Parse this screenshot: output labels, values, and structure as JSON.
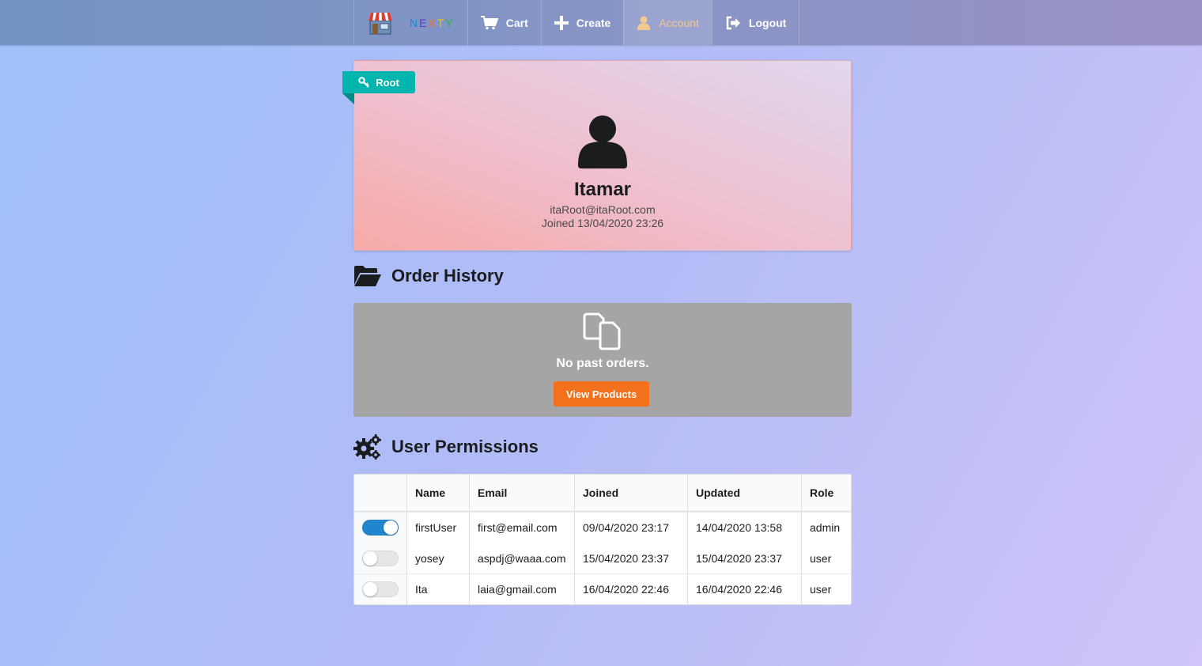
{
  "nav": {
    "brand": "NEXTY",
    "cart": "Cart",
    "create": "Create",
    "account": "Account",
    "logout": "Logout",
    "accent": "#f2c894"
  },
  "profile": {
    "role_badge": "Root",
    "name": "Itamar",
    "email": "itaRoot@itaRoot.com",
    "joined": "Joined 13/04/2020 23:26"
  },
  "orders": {
    "title": "Order History",
    "empty_text": "No past orders.",
    "button": "View Products",
    "button_color": "#f2711c"
  },
  "permissions": {
    "title": "User Permissions",
    "columns": [
      "",
      "Name",
      "Email",
      "Joined",
      "Updated",
      "Role"
    ],
    "rows": [
      {
        "enabled": true,
        "name": "firstUser",
        "email": "first@email.com",
        "joined": "09/04/2020 23:17",
        "updated": "14/04/2020 13:58",
        "role": "admin"
      },
      {
        "enabled": false,
        "name": "yosey",
        "email": "aspdj@waaa.com",
        "joined": "15/04/2020 23:37",
        "updated": "15/04/2020 23:37",
        "role": "user"
      },
      {
        "enabled": false,
        "name": "Ita",
        "email": "laia@gmail.com",
        "joined": "16/04/2020 22:46",
        "updated": "16/04/2020 22:46",
        "role": "user"
      }
    ],
    "toggle_on_color": "#2185d0"
  }
}
